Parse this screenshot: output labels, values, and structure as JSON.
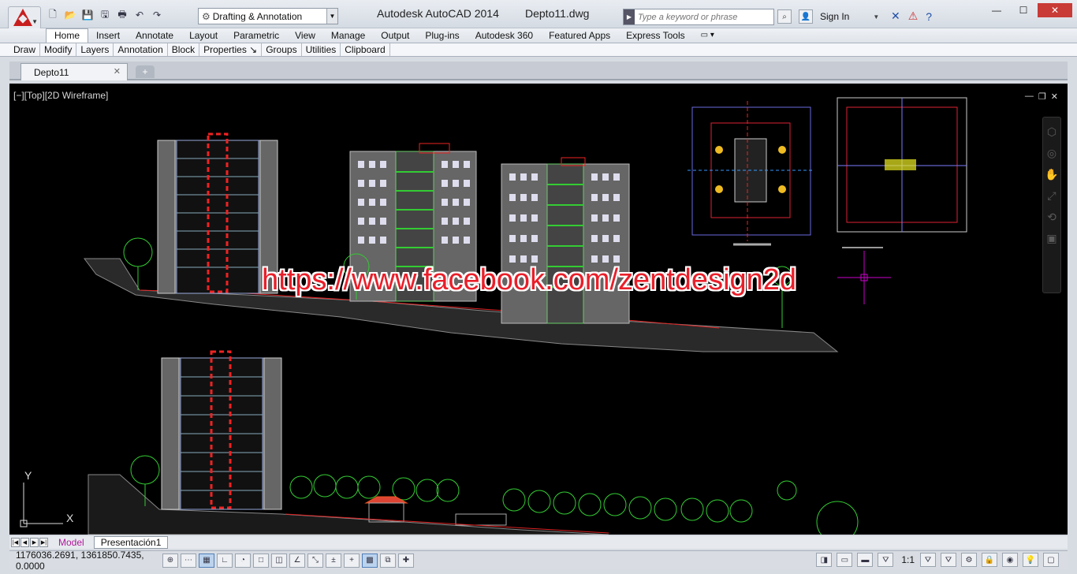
{
  "window": {
    "app_title": "Autodesk AutoCAD 2014",
    "file_title": "Depto11.dwg",
    "workspace": "Drafting & Annotation",
    "search_placeholder": "Type a keyword or phrase",
    "sign_in": "Sign In"
  },
  "ribbon": {
    "tabs": [
      "Home",
      "Insert",
      "Annotate",
      "Layout",
      "Parametric",
      "View",
      "Manage",
      "Output",
      "Plug-ins",
      "Autodesk 360",
      "Featured Apps",
      "Express Tools"
    ],
    "active_tab": "Home",
    "panels": [
      "Draw",
      "Modify",
      "Layers",
      "Annotation",
      "Block",
      "Properties ↘",
      "Groups",
      "Utilities",
      "Clipboard"
    ]
  },
  "document": {
    "tab_label": "Depto11"
  },
  "viewport": {
    "label": "[−][Top][2D Wireframe]",
    "watermark": "https://www.facebook.com/zentdesign2d",
    "ucs_x": "X",
    "ucs_y": "Y"
  },
  "layout_tabs": {
    "model": "Model",
    "layout1": "Presentación1"
  },
  "status": {
    "coordinates": "1176036.2691, 1361850.7435, 0.0000",
    "scale": "1:1"
  },
  "colors": {
    "viewport_bg": "#000000",
    "accent_red": "#e91f2a",
    "model_tab": "#b0189a"
  }
}
